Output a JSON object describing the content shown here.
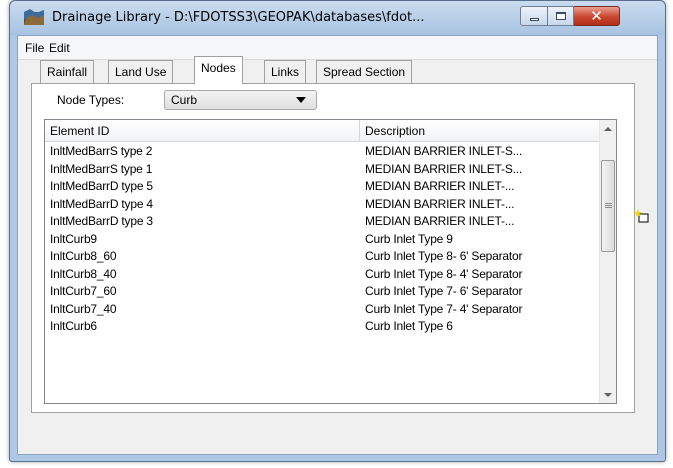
{
  "window": {
    "title": "Drainage Library - D:\\FDOTSS3\\GEOPAK\\databases\\fdot...",
    "icon": "drainage-library-app-icon"
  },
  "menubar": {
    "file": "File",
    "edit": "Edit"
  },
  "tabs": [
    {
      "label": "Rainfall",
      "active": false
    },
    {
      "label": "Land Use",
      "active": false
    },
    {
      "label": "Nodes",
      "active": true
    },
    {
      "label": "Links",
      "active": false
    },
    {
      "label": "Spread Section",
      "active": false
    }
  ],
  "nodes": {
    "node_types_label": "Node Types:",
    "node_types_selected": "Curb"
  },
  "list": {
    "columns": [
      "Element ID",
      "Description"
    ],
    "rows": [
      [
        "InltMedBarrS type 2",
        "MEDIAN BARRIER INLET-S..."
      ],
      [
        "InltMedBarrS type 1",
        "MEDIAN BARRIER INLET-S..."
      ],
      [
        "InltMedBarrD type 5",
        "MEDIAN BARRIER INLET-..."
      ],
      [
        "InltMedBarrD type 4",
        "MEDIAN BARRIER INLET-..."
      ],
      [
        "InltMedBarrD type 3",
        "MEDIAN BARRIER INLET-..."
      ],
      [
        "InltCurb9",
        "Curb Inlet Type 9"
      ],
      [
        "InltCurb8_60",
        "Curb Inlet Type 8- 6' Separator"
      ],
      [
        "InltCurb8_40",
        "Curb Inlet Type 8- 4' Separator"
      ],
      [
        "InltCurb7_60",
        "Curb Inlet Type 7- 6' Separator"
      ],
      [
        "InltCurb7_40",
        "Curb Inlet Type 7- 4' Separator"
      ],
      [
        "InltCurb6",
        "Curb Inlet Type 6"
      ]
    ]
  },
  "side_tools": {
    "new_icon": "new-item-icon"
  },
  "colors": {
    "frame": "#aec7e4",
    "close_button": "#c9452d",
    "dialog_bg": "#f0f0f0"
  }
}
